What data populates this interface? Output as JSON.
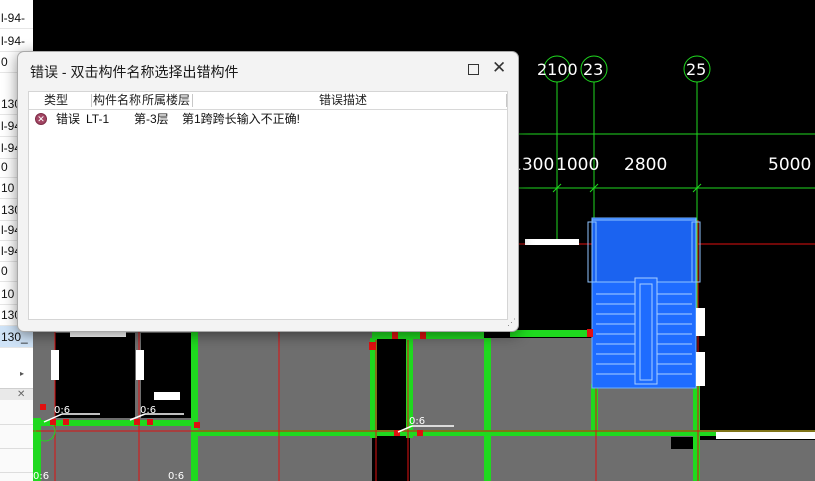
{
  "left_panel": {
    "rows": [
      {
        "text": "l-94-"
      },
      {
        "text": "l-94-"
      },
      {
        "text": "0"
      },
      {
        "text": "130_"
      },
      {
        "text": "l-94-"
      },
      {
        "text": "l-94-"
      },
      {
        "text": "0"
      },
      {
        "text": "10"
      },
      {
        "text": "130_"
      },
      {
        "text": "l-94-"
      },
      {
        "text": "l-94-"
      },
      {
        "text": "0"
      },
      {
        "text": "10"
      },
      {
        "text": "130_"
      },
      {
        "text": "130_"
      }
    ],
    "collapse_arrow": "▸",
    "close_glyph": "✕"
  },
  "cad": {
    "axis_labels": [
      "2100",
      "23",
      "25"
    ],
    "dimensions": [
      "1300",
      "1000",
      "2800",
      "5000"
    ],
    "slab_labels": [
      "0:6",
      "0:6",
      "0:6",
      "0:6",
      "0:6"
    ],
    "colors": {
      "background": "#000000",
      "wall": "#1fd91f",
      "axis": "#e01010",
      "room": "#6e6e6e",
      "stair": "#1e6cff"
    }
  },
  "dialog": {
    "title": "错误 - 双击构件名称选择出错构件",
    "maximize_icon": "maximize-icon",
    "close_icon": "✕",
    "columns": {
      "type": "类型",
      "name": "构件名称",
      "floor": "所属楼层",
      "desc": "错误描述"
    },
    "rows": [
      {
        "icon": "error-icon",
        "type": "错误",
        "name": "LT-1",
        "floor": "第-3层",
        "desc": "第1跨跨长输入不正确!"
      }
    ]
  }
}
